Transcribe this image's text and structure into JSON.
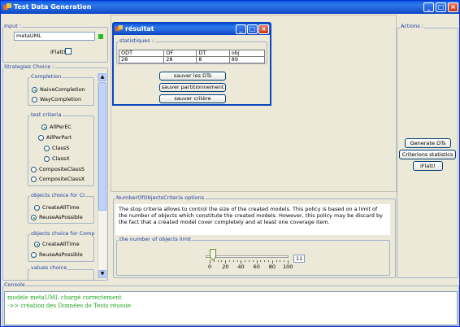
{
  "window": {
    "title": "Test Data Generation"
  },
  "input": {
    "legend": "Input :",
    "model_value": "metaUML",
    "iflatt_label": "iFlatt!"
  },
  "strategies": {
    "legend": "Strategies Choice :",
    "completion": {
      "legend": "Completion",
      "options": [
        "NaiveCompletion",
        "WayCompletion"
      ],
      "selected": "NaiveCompletion"
    },
    "test_criteria": {
      "legend": "test criteria",
      "options": [
        "AllPerEC",
        "AllPerPart",
        "ClassS",
        "ClassX",
        "CompositeClassS",
        "CompositeClassX"
      ],
      "selected": "AllPerEC"
    },
    "objects_ci": {
      "legend": "objects choice for CI",
      "options": [
        "CreateAllTime",
        "ReuseAsPossible"
      ],
      "selected": "ReuseAsPossible"
    },
    "objects_comp": {
      "legend": "objects choice for Comp",
      "options": [
        "CreateAllTime",
        "ReuseAsPossible"
      ],
      "selected": "CreateAllTime"
    },
    "values_choice": {
      "legend": "values choice"
    }
  },
  "result_dialog": {
    "title": "résultat",
    "stats_legend": "statistiques :",
    "table": {
      "headers": [
        "ODT",
        "OF",
        "DT",
        "obj"
      ],
      "values": [
        "28",
        "28",
        "8",
        "89"
      ]
    },
    "buttons": [
      "sauver les DTs",
      "sauver partitionnement",
      "sauver critère"
    ]
  },
  "actions": {
    "legend": "Actions :",
    "buttons": [
      "Generate DTs",
      "Criterions statistics",
      "iFlatt!"
    ]
  },
  "options": {
    "legend": "NumberOfObjectsCriteria options",
    "description": "The stop criteria allows to control the size of the created models. This policy is based on a limit of the number of objects which constitute the created models. However, this policy may be discard by the fact that a created model cover completely and at least one coverage item.",
    "limit_legend": "the number of objects limit",
    "slider": {
      "min": 0,
      "max": 100,
      "value": 11,
      "ticks": [
        "0",
        "20",
        "40",
        "60",
        "80",
        "100"
      ]
    },
    "value_text": "11"
  },
  "console": {
    "legend": "Console",
    "lines": [
      "modèle metaUML chargé correctement",
      "->> création des Données de Tests réussie"
    ]
  },
  "colors": {
    "titlebar": "#0a5be0",
    "accent": "#1c3fa8",
    "console_text": "#1ea51e",
    "status_ok": "#22c022"
  }
}
